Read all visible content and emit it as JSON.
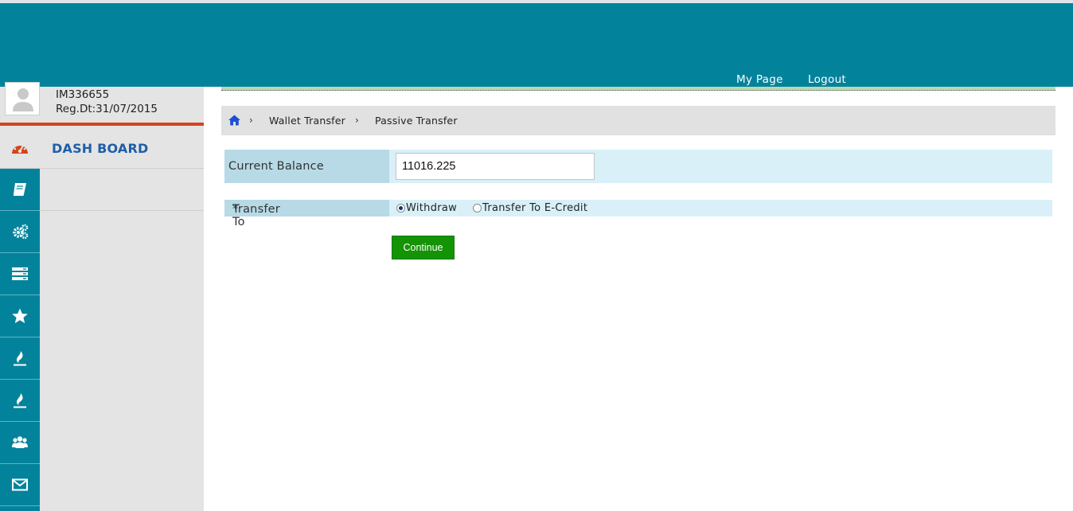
{
  "header": {
    "my_page": "My Page",
    "logout": "Logout"
  },
  "user": {
    "id": "IM336655",
    "reg_date": "Reg.Dt:31/07/2015"
  },
  "sidebar": {
    "dashboard_label": "DASH BOARD",
    "icons": [
      "book-icon",
      "gears-icon",
      "server-icon",
      "star-icon",
      "fire-icon",
      "fire-icon",
      "users-icon",
      "envelope-icon"
    ]
  },
  "breadcrumb": {
    "items": [
      "Wallet Transfer",
      "Passive Transfer"
    ]
  },
  "form": {
    "balance_label": "Current Balance",
    "balance_value": "11016.225",
    "transfer_label": "Transfer To",
    "required_mark": "*",
    "options": [
      {
        "label": "Withdraw",
        "selected": true
      },
      {
        "label": "Transfer To E-Credit",
        "selected": false
      }
    ],
    "continue_label": "Continue"
  },
  "colors": {
    "header": "#03839b",
    "accent_red": "#d5441b",
    "dashboard_text": "#1f5ea8",
    "button": "#149304"
  }
}
